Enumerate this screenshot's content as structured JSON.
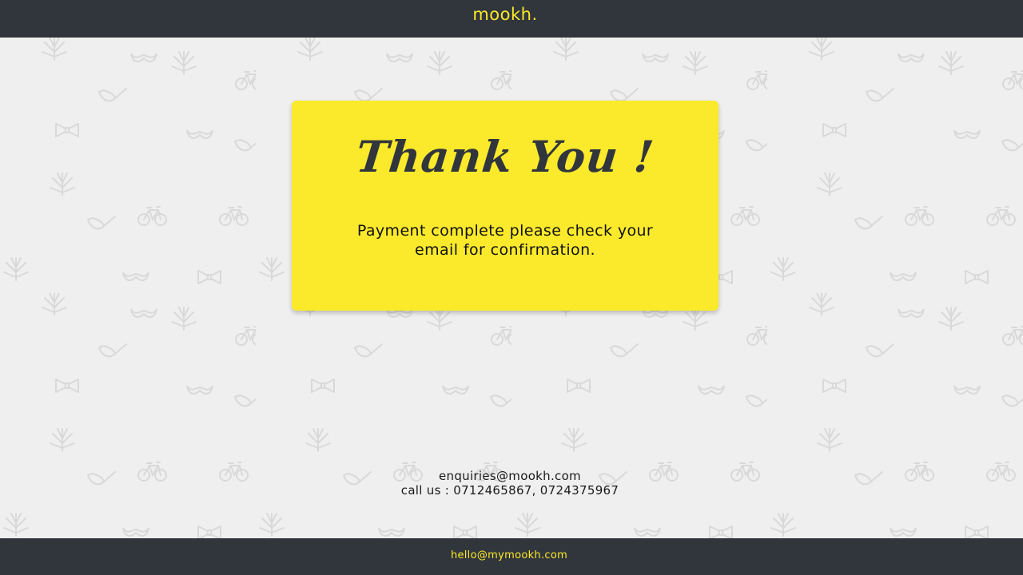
{
  "header": {
    "logo": "mookh."
  },
  "card": {
    "heading": "Thank You !",
    "message": "Payment complete please check your email for confirmation."
  },
  "contact": {
    "email": "enquiries@mookh.com",
    "phone": "call us : 0712465867, 0724375967"
  },
  "footer": {
    "email": "hello@mymookh.com"
  },
  "colors": {
    "bar": "#31363d",
    "accent": "#fbe928",
    "card": "#fbea2b",
    "background": "#efefef"
  },
  "pattern_icons": [
    "leaf-icon",
    "bicycle-icon",
    "mustache-icon",
    "pipe-icon",
    "bowtie-icon"
  ]
}
